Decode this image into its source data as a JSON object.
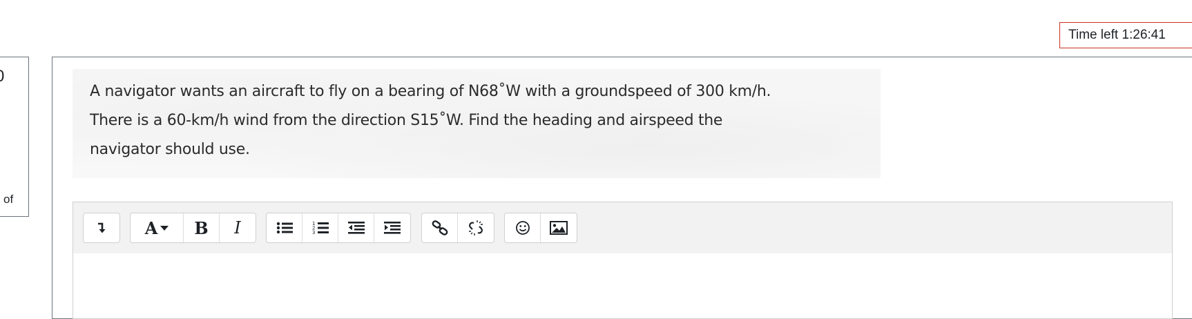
{
  "timer": {
    "label": "Time left 1:26:41"
  },
  "info_panel": {
    "number": "0",
    "fragment": "of"
  },
  "question": {
    "lines": [
      "A navigator wants an aircraft to fly on a bearing of N68˚W with a groundspeed of 300 km/h.",
      "There is a 60-km/h wind from the direction S15˚W.  Find the heading and airspeed the",
      "navigator should use."
    ]
  },
  "editor": {
    "toolbar": {
      "groups": [
        {
          "buttons": [
            {
              "icon": "collapse-toggle-icon"
            }
          ]
        },
        {
          "buttons": [
            {
              "icon": "font-style-icon",
              "label": "A"
            },
            {
              "icon": "bold-icon",
              "label": "B"
            },
            {
              "icon": "italic-icon",
              "label": "I"
            }
          ]
        },
        {
          "buttons": [
            {
              "icon": "unordered-list-icon"
            },
            {
              "icon": "ordered-list-icon"
            },
            {
              "icon": "outdent-icon"
            },
            {
              "icon": "indent-icon"
            }
          ]
        },
        {
          "buttons": [
            {
              "icon": "link-icon"
            },
            {
              "icon": "unlink-icon"
            }
          ]
        },
        {
          "buttons": [
            {
              "icon": "emoticon-icon"
            },
            {
              "icon": "image-icon"
            }
          ]
        }
      ]
    },
    "content": ""
  }
}
